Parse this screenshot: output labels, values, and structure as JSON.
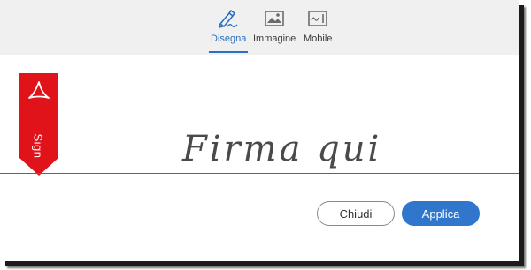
{
  "tabs": [
    {
      "label": "Disegna",
      "icon": "pen-draw-icon",
      "active": true
    },
    {
      "label": "Immagine",
      "icon": "image-icon",
      "active": false
    },
    {
      "label": "Mobile",
      "icon": "mobile-device-icon",
      "active": false
    }
  ],
  "ribbon": {
    "label": "Sign",
    "icon": "acrobat-icon",
    "color": "#e0121a"
  },
  "signature": {
    "placeholder": "Firma qui"
  },
  "buttons": {
    "close": "Chiudi",
    "apply": "Applica"
  },
  "colors": {
    "accent": "#2b6fbf",
    "apply": "#2f76cc",
    "toolbar": "#f0f0f0"
  }
}
